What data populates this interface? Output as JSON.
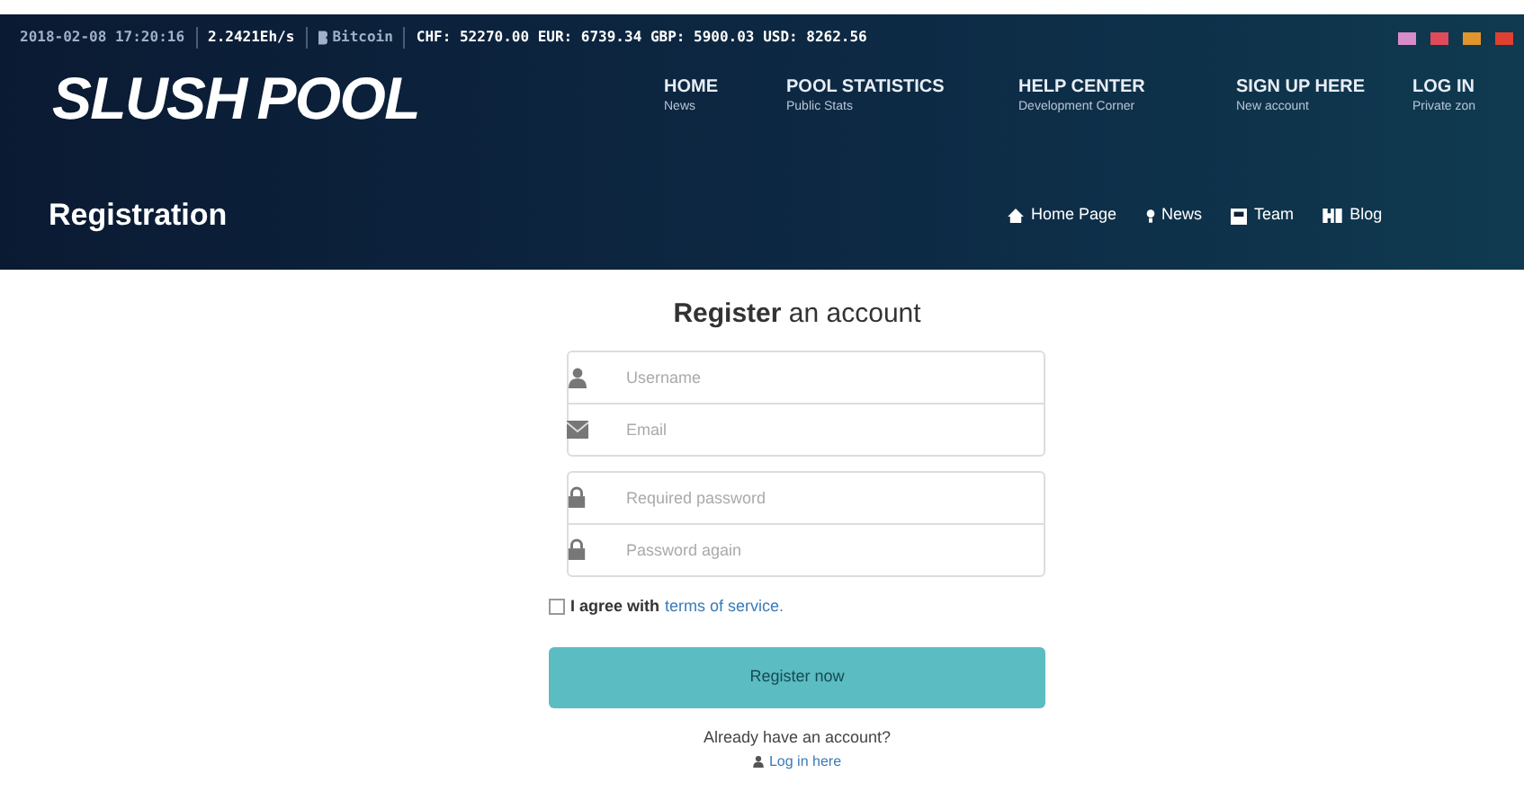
{
  "ticker": {
    "datetime": "2018-02-08 17:20:16",
    "hashrate": "2.2421Eh/s",
    "coin": "Bitcoin",
    "prices": "CHF: 52270.00 EUR: 6739.34 GBP: 5900.03 USD: 8262.56"
  },
  "flags": [
    {
      "color": "#d58cc8"
    },
    {
      "color": "#e04a5a"
    },
    {
      "color": "#e0962c"
    },
    {
      "color": "#e04030"
    }
  ],
  "logo": {
    "word_1": "SLUSH",
    "word_2": "POOL"
  },
  "nav": [
    {
      "title": "HOME",
      "subtitle": "News"
    },
    {
      "title": "POOL STATISTICS",
      "subtitle": "Public Stats"
    },
    {
      "title": "HELP CENTER",
      "subtitle": "Development Corner"
    },
    {
      "title": "SIGN UP HERE",
      "subtitle": "New account"
    },
    {
      "title": "LOG IN",
      "subtitle": "Private zon"
    }
  ],
  "page_title": "Registration",
  "subnav": [
    {
      "kind": "home",
      "label": "Home Page"
    },
    {
      "kind": "news",
      "label": "News"
    },
    {
      "kind": "team",
      "label": "Team"
    },
    {
      "kind": "blog",
      "label": "Blog"
    }
  ],
  "form": {
    "heading": "**Register** an account",
    "field_groups": [
      [
        {
          "kind": "user",
          "placeholder": "Username"
        },
        {
          "kind": "email",
          "placeholder": "Email"
        }
      ],
      [
        {
          "kind": "lock",
          "placeholder": "Required password"
        },
        {
          "kind": "lock",
          "placeholder": "Password again"
        }
      ]
    ],
    "agree": {
      "checked": false,
      "text": "I agree with",
      "link": "terms of service."
    },
    "submit": "Register now",
    "login_prompt": "Already have an account?",
    "login_link": "Log in here"
  }
}
